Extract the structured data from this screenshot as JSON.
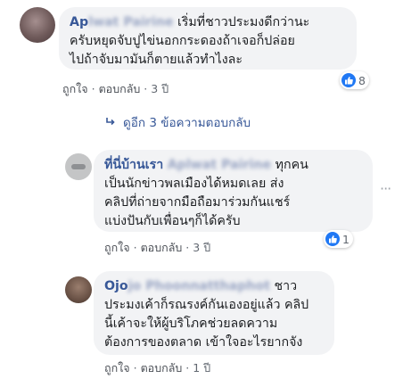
{
  "comments": [
    {
      "author": "Aplwat Pairine",
      "text_line1": " เริ่มที่ชาวประมงดีกว่านะ",
      "text_lines": "ครับหยุดจับปูไข่นอกกระดองถ้าเจอก็ปล่อยไปถ้าจับมามันก็ตายแล้วทำไงละ",
      "line2": "ครับหยุดจับปูไข่นอกกระดองถ้าเจอก็ปล่อย",
      "line3": "ไปถ้าจับมามันก็ตายแล้วทำไงละ",
      "like_label": "ถูกใจ",
      "reply_label": "ตอบกลับ",
      "time": "3 ปี",
      "reaction_count": "8"
    },
    {
      "author": "ที่นี่บ้านเรา",
      "tagged": "Aplwat Pairine",
      "text_line1": " ทุกคน",
      "line2": "เป็นนักข่าวพลเมืองได้หมดเลย ส่ง",
      "line3": "คลิปที่ถ่ายจากมือถือมาร่วมกันแชร์",
      "line4": "แบ่งปันกับเพื่อนๆก็ได้ครับ",
      "like_label": "ถูกใจ",
      "reply_label": "ตอบกลับ",
      "time": "3 ปี",
      "reaction_count": "1"
    },
    {
      "author": "Ojo",
      "author_blur": "jo Phoonnatthaphot",
      "text_line1": " ชาว",
      "line2": "ประมงเค้าก็รณรงค์กันเองอยู่แล้ว คลิป",
      "line3": "นี้เค้าจะให้ผู้บริโภคช่วยลดความ",
      "line4": "ต้องการของตลาด เข้าใจอะไรยากจัง",
      "like_label": "ถูกใจ",
      "reply_label": "ตอบกลับ",
      "time": "1 ปี"
    }
  ],
  "more_replies": "ดูอีก 3 ข้อความตอบกลับ",
  "colors": {
    "link": "#385898",
    "bubble": "#f2f3f5",
    "like": "#2078f4"
  },
  "icons": [
    "like-icon",
    "reply-arrow-icon",
    "more-options-icon"
  ]
}
